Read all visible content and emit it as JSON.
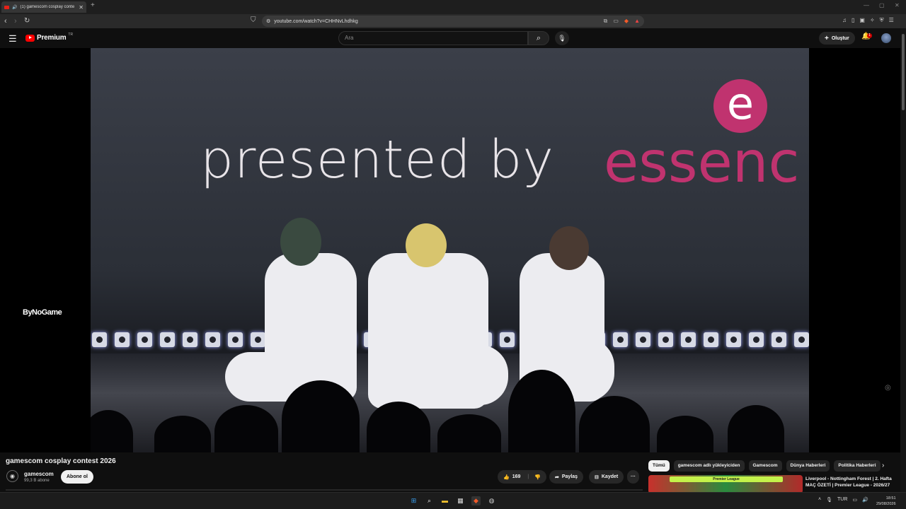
{
  "browser": {
    "tab_title": "(1) gamescom cosplay conte",
    "tab_close": "✕",
    "new_tab": "+",
    "url": "youtube.com/watch?v=CHHNvLhdhkg",
    "window_controls": [
      "—",
      "▢",
      "✕"
    ]
  },
  "youtube": {
    "logo_text": "Premium",
    "logo_region": "TR",
    "search_placeholder": "Ara",
    "create_label": "Oluştur",
    "notification_count": "1"
  },
  "video": {
    "overlay_text_left": "presented by",
    "overlay_text_right": "essenc",
    "overlay_logo_letter": "e",
    "watermark": "ByNoGame",
    "title": "gamescom cosplay contest 2026",
    "channel_name": "gamescom",
    "channel_subscribers": "99,3 B abone",
    "subscribe_label": "Abone ol",
    "like_count": "169",
    "share_label": "Paylaş",
    "save_label": "Kaydet",
    "more_label": "···"
  },
  "chips": [
    "Tümü",
    "gamescom adlı yükleyiciden",
    "Gamescom",
    "Dünya Haberleri",
    "Politika Haberleri"
  ],
  "recommendation": {
    "thumb_label": "Premier League",
    "title": "Liverpool - Nottingham Forest | 2. Hafta MAÇ ÖZETİ | Premier League - 2026/27"
  },
  "taskbar": {
    "language": "TUR",
    "time": "18:51",
    "date": "29/08/2026"
  },
  "colors": {
    "youtube_red": "#ff0000",
    "brand_pink": "#c0336f",
    "background": "#0f0f0f"
  }
}
